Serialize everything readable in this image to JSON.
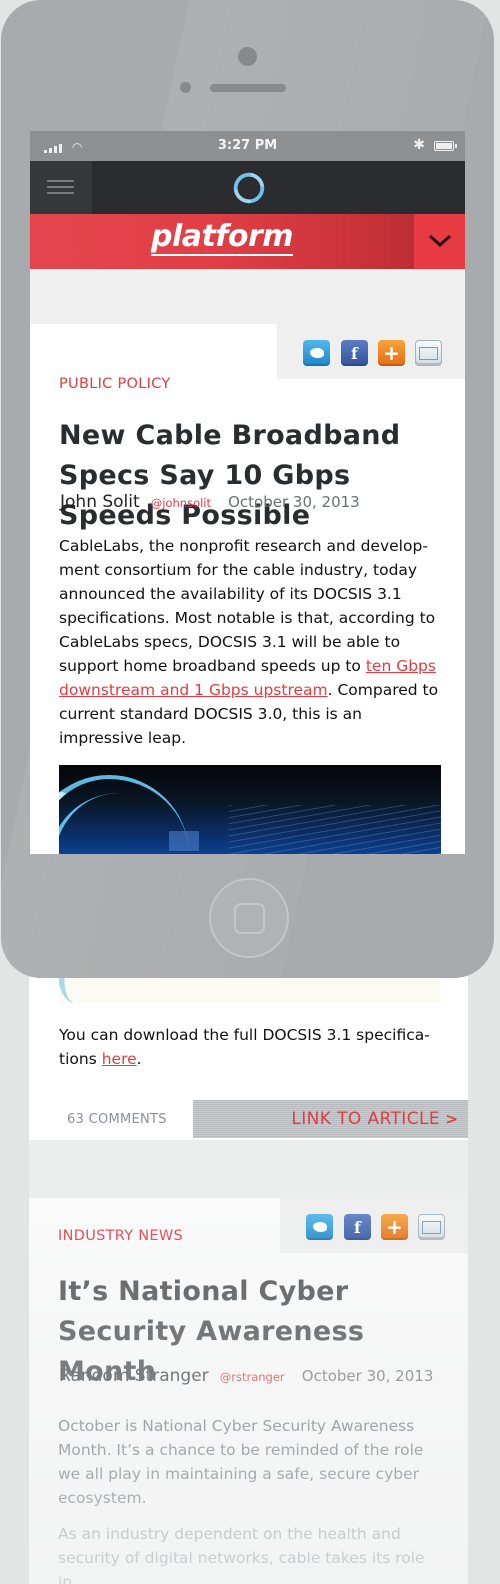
{
  "status_bar": {
    "time": "3:27 PM"
  },
  "header": {
    "wordmark": "platform"
  },
  "articles": [
    {
      "category": "PUBLIC POLICY",
      "title": "New Cable Broadband Specs Say 10 Gbps Speeds Possible",
      "author": "John Solit",
      "handle": "@johnsolit",
      "date": "October 30, 2013",
      "body_before_link": "CableLabs, the nonprofit research and develop­ment consortium for the cable industry, today announced the availability of its DOCSIS 3.1 speci­fications. Most notable is that, according to Cable­Labs specs, DOCSIS 3.1 will be able to support home broadband speeds up to ",
      "body_link": "ten Gbps down­stream and 1 Gbps upstream",
      "body_after_link": ". Compared to cur­rent standard DOCSIS 3.0, this is an impressive leap.",
      "download_text": "You can download the full DOCSIS 3.1 specifica­tions ",
      "download_link": "here",
      "download_end": ".",
      "comments": "63 COMMENTS",
      "link_label": "LINK TO ARTICLE"
    },
    {
      "category": "INDUSTRY NEWS",
      "title": "It’s National Cyber Security Awareness Month",
      "author": "Random Stranger",
      "handle": "@rstranger",
      "date": "October 30, 2013",
      "body": "October is National Cyber Security Awareness Month. It’s a chance to be reminded of the role we all play in maintaining a safe, secure cyber ecosys­tem.",
      "body2": "As an industry dependent on the health and secu­rity of digital networks, cable takes its role in"
    }
  ],
  "share_icons": [
    "twitter-icon",
    "facebook-icon",
    "plus-share-icon",
    "email-icon"
  ],
  "colors": {
    "accent": "#e23b43",
    "nav_dark": "#2a2c2f",
    "phone_body": "#a8abad",
    "link_gray": "#8a9096"
  }
}
